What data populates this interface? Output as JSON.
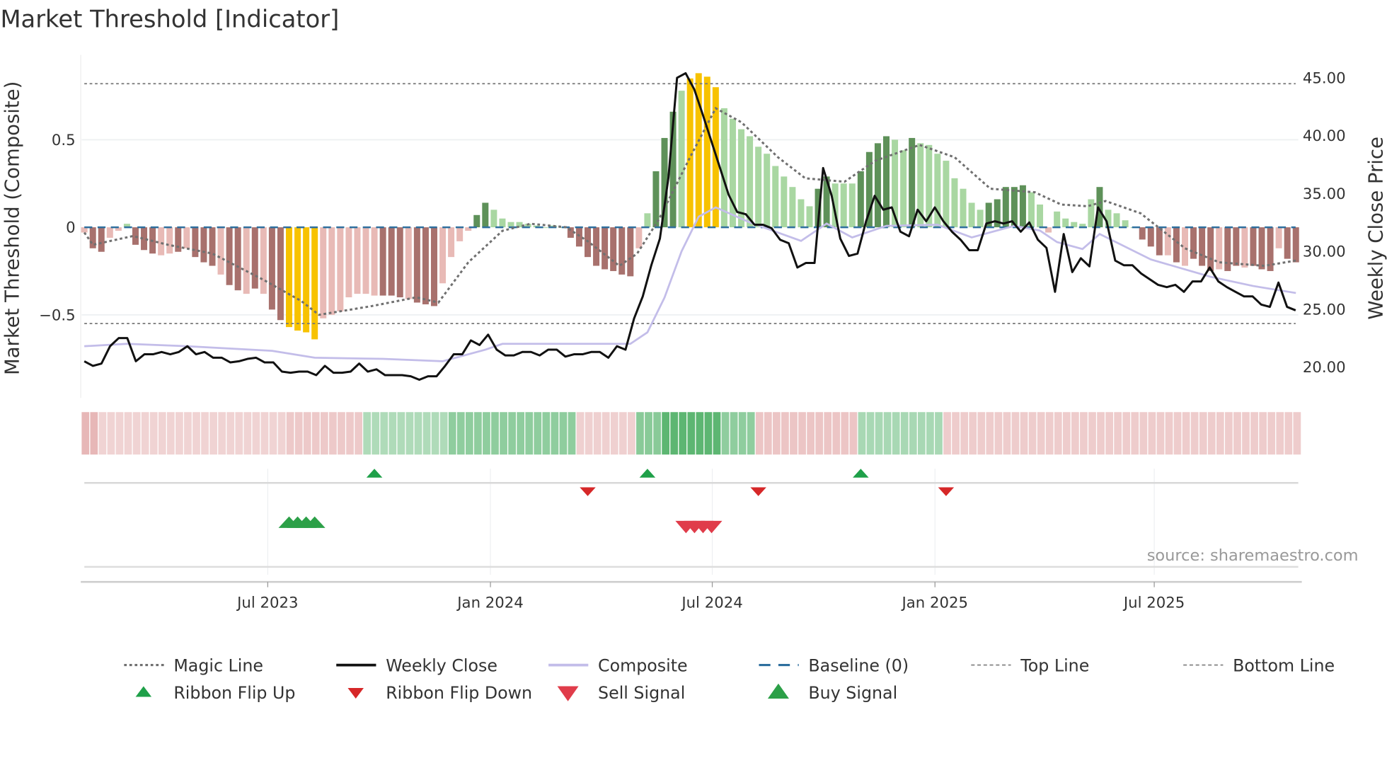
{
  "chart_data": {
    "type": "bar",
    "title": "Market Threshold [Indicator]",
    "ylabel": "Market Threshold (Composite)",
    "ylabel_right": "Weekly Close Price",
    "ylim": [
      -0.96,
      0.97
    ],
    "ylim_right": [
      16.5,
      47.5
    ],
    "yticks": [
      {
        "v": 0.5,
        "label": "0.5"
      },
      {
        "v": 0,
        "label": "0"
      },
      {
        "v": -0.5,
        "label": "−0.5"
      }
    ],
    "yticks_right": [
      {
        "v": 45,
        "label": "45.00"
      },
      {
        "v": 40,
        "label": "40.00"
      },
      {
        "v": 35,
        "label": "35.00"
      },
      {
        "v": 30,
        "label": "30.00"
      },
      {
        "v": 25,
        "label": "25.00"
      },
      {
        "v": 20,
        "label": "20.00"
      }
    ],
    "xticks": [
      {
        "week": 21.5,
        "label": "Jul 2023"
      },
      {
        "week": 47.6,
        "label": "Jan 2024"
      },
      {
        "week": 73.6,
        "label": "Jul 2024"
      },
      {
        "week": 99.7,
        "label": "Jan 2025"
      },
      {
        "week": 125.4,
        "label": "Jul 2025"
      }
    ],
    "top_line": 0.82,
    "bottom_line": -0.55,
    "baseline": 0,
    "composite_bars": [
      -0.03,
      -0.12,
      -0.14,
      -0.06,
      -0.02,
      0.02,
      -0.1,
      -0.13,
      -0.15,
      -0.16,
      -0.15,
      -0.14,
      -0.12,
      -0.17,
      -0.2,
      -0.22,
      -0.27,
      -0.33,
      -0.36,
      -0.38,
      -0.35,
      -0.38,
      -0.47,
      -0.53,
      -0.57,
      -0.59,
      -0.6,
      -0.64,
      -0.52,
      -0.5,
      -0.48,
      -0.4,
      -0.38,
      -0.38,
      -0.39,
      -0.39,
      -0.39,
      -0.4,
      -0.41,
      -0.43,
      -0.44,
      -0.45,
      -0.32,
      -0.17,
      -0.08,
      -0.02,
      0.07,
      0.14,
      0.1,
      0.05,
      0.03,
      0.03,
      0.02,
      0.01,
      0.0,
      0.01,
      0.0,
      -0.06,
      -0.11,
      -0.17,
      -0.22,
      -0.24,
      -0.25,
      -0.27,
      -0.28,
      -0.12,
      0.08,
      0.32,
      0.51,
      0.66,
      0.78,
      0.85,
      0.88,
      0.86,
      0.8,
      0.68,
      0.62,
      0.56,
      0.52,
      0.46,
      0.42,
      0.35,
      0.29,
      0.23,
      0.16,
      0.12,
      0.22,
      0.29,
      0.25,
      0.25,
      0.25,
      0.32,
      0.43,
      0.48,
      0.52,
      0.5,
      0.44,
      0.51,
      0.48,
      0.47,
      0.42,
      0.38,
      0.28,
      0.22,
      0.14,
      0.1,
      0.14,
      0.16,
      0.23,
      0.23,
      0.24,
      0.2,
      0.13,
      -0.03,
      0.09,
      0.05,
      0.03,
      0.02,
      0.16,
      0.23,
      0.1,
      0.08,
      0.04,
      0.0,
      -0.07,
      -0.11,
      -0.16,
      -0.16,
      -0.2,
      -0.22,
      -0.18,
      -0.22,
      -0.25,
      -0.24,
      -0.25,
      -0.22,
      -0.23,
      -0.22,
      -0.24,
      -0.25,
      -0.12,
      -0.18,
      -0.2
    ],
    "bar_states": "LDDLLgDDDLLDLDDDLDDLDLDDYYYYLLLLLLLDDDLDDDLLLLGGgggggggggDDDDDDDDLgGGGgYYYYgggggggggggGGgggGGGGggGggggggggGGGGGggLgggggGggggDDDLDLDDDLDDLDDDLDD",
    "bar_state_colors": {
      "D": "#a8716d",
      "L": "#e8bab6",
      "Y": "#f7c200",
      "G": "#5e9159",
      "g": "#a9d7a2"
    },
    "weekly_close": [
      20.5,
      20.1,
      20.3,
      21.8,
      22.5,
      22.5,
      20.5,
      21.1,
      21.1,
      21.3,
      21.1,
      21.3,
      21.8,
      21.1,
      21.3,
      20.8,
      20.8,
      20.4,
      20.5,
      20.7,
      20.8,
      20.4,
      20.4,
      19.6,
      19.5,
      19.6,
      19.6,
      19.3,
      20.1,
      19.5,
      19.5,
      19.6,
      20.3,
      19.6,
      19.8,
      19.3,
      19.3,
      19.3,
      19.2,
      18.9,
      19.2,
      19.2,
      20.1,
      21.1,
      21.1,
      22.3,
      21.9,
      22.8,
      21.5,
      21.0,
      21.0,
      21.3,
      21.3,
      21.0,
      21.5,
      21.5,
      20.9,
      21.1,
      21.1,
      21.3,
      21.3,
      20.8,
      21.8,
      21.5,
      24.2,
      26.1,
      28.8,
      31.1,
      36.4,
      45.0,
      45.4,
      44.0,
      41.8,
      39.5,
      37.2,
      34.9,
      33.4,
      33.2,
      32.3,
      32.3,
      32.0,
      31.0,
      30.7,
      28.6,
      29.0,
      29.0,
      37.2,
      34.8,
      31.1,
      29.6,
      29.8,
      32.6,
      34.8,
      33.6,
      33.8,
      31.7,
      31.3,
      33.6,
      32.6,
      33.8,
      32.6,
      31.7,
      31.0,
      30.1,
      30.1,
      32.4,
      32.6,
      32.4,
      32.6,
      31.7,
      32.5,
      31.0,
      30.3,
      26.5,
      31.5,
      28.2,
      29.4,
      28.7,
      33.8,
      32.6,
      29.2,
      28.8,
      28.8,
      28.1,
      27.6,
      27.1,
      26.9,
      27.1,
      26.5,
      27.4,
      27.4,
      28.6,
      27.4,
      26.9,
      26.5,
      26.1,
      26.1,
      25.4,
      25.2,
      27.3,
      25.2,
      24.9
    ],
    "composite_line": [
      [
        0,
        21.8
      ],
      [
        5,
        22
      ],
      [
        12,
        21.8
      ],
      [
        22,
        21.4
      ],
      [
        27,
        20.8
      ],
      [
        35,
        20.7
      ],
      [
        42,
        20.5
      ],
      [
        47,
        21.5
      ],
      [
        49,
        22
      ],
      [
        56,
        22
      ],
      [
        64,
        22
      ],
      [
        66,
        23
      ],
      [
        68,
        26
      ],
      [
        70,
        30
      ],
      [
        72,
        33
      ],
      [
        74,
        33.8
      ],
      [
        78,
        32.5
      ],
      [
        84,
        30.9
      ],
      [
        87,
        32.4
      ],
      [
        90,
        31.2
      ],
      [
        94,
        32.2
      ],
      [
        100,
        32.3
      ],
      [
        104,
        31.2
      ],
      [
        109,
        32.2
      ],
      [
        112,
        31.8
      ],
      [
        114,
        30.8
      ],
      [
        117,
        30.2
      ],
      [
        119,
        31.5
      ],
      [
        125,
        29.3
      ],
      [
        132,
        27.8
      ],
      [
        137,
        27
      ],
      [
        142,
        26.4
      ]
    ],
    "magic_line": [
      [
        0,
        -0.03
      ],
      [
        1,
        -0.1
      ],
      [
        5.7,
        -0.05
      ],
      [
        9.8,
        -0.1
      ],
      [
        15,
        -0.15
      ],
      [
        21,
        -0.3
      ],
      [
        25.4,
        -0.42
      ],
      [
        27.5,
        -0.5
      ],
      [
        33.7,
        -0.45
      ],
      [
        38.9,
        -0.4
      ],
      [
        41.5,
        -0.43
      ],
      [
        45,
        -0.2
      ],
      [
        49,
        -0.02
      ],
      [
        52.3,
        0.02
      ],
      [
        56.5,
        0
      ],
      [
        59,
        -0.08
      ],
      [
        62.7,
        -0.22
      ],
      [
        64.8,
        -0.15
      ],
      [
        67.4,
        0.05
      ],
      [
        71,
        0.4
      ],
      [
        74,
        0.68
      ],
      [
        77,
        0.6
      ],
      [
        81.3,
        0.4
      ],
      [
        84.5,
        0.28
      ],
      [
        89.1,
        0.26
      ],
      [
        92.7,
        0.38
      ],
      [
        97.9,
        0.47
      ],
      [
        102,
        0.4
      ],
      [
        106.2,
        0.22
      ],
      [
        111.4,
        0.2
      ],
      [
        114.5,
        0.13
      ],
      [
        117.6,
        0.12
      ],
      [
        119.7,
        0.15
      ],
      [
        123.8,
        0.08
      ],
      [
        129,
        -0.12
      ],
      [
        133,
        -0.2
      ],
      [
        138.3,
        -0.22
      ],
      [
        142,
        -0.19
      ]
    ],
    "ribbon_segments": [
      {
        "from": 0,
        "to": 2,
        "v": -0.7
      },
      {
        "from": 2,
        "to": 24,
        "v": -0.3
      },
      {
        "from": 24,
        "to": 33,
        "v": -0.45
      },
      {
        "from": 33,
        "to": 43,
        "v": 0.3
      },
      {
        "from": 43,
        "to": 58,
        "v": 0.55
      },
      {
        "from": 58,
        "to": 65,
        "v": -0.35
      },
      {
        "from": 65,
        "to": 68,
        "v": 0.6
      },
      {
        "from": 68,
        "to": 75,
        "v": 0.95
      },
      {
        "from": 75,
        "to": 79,
        "v": 0.55
      },
      {
        "from": 79,
        "to": 91,
        "v": -0.5
      },
      {
        "from": 91,
        "to": 101,
        "v": 0.35
      },
      {
        "from": 101,
        "to": 143,
        "v": -0.4
      }
    ],
    "ribbon_flip_up": [
      34,
      66,
      91
    ],
    "ribbon_flip_down": [
      59,
      79,
      101
    ],
    "buy_signals": [
      24,
      25,
      26,
      27
    ],
    "sell_signals": [
      70,
      71,
      72,
      73
    ],
    "colors": {
      "weekly_close": "#111111",
      "composite": "#c3bde9",
      "magic": "#707070",
      "baseline": "#2e6f9e",
      "flip_up": "#1fa049",
      "flip_down": "#d62728",
      "buy": "#2ca048",
      "sell": "#e03c4a"
    },
    "legend": [
      {
        "label": "Magic Line",
        "key": "magic"
      },
      {
        "label": "Weekly Close",
        "key": "close"
      },
      {
        "label": "Composite",
        "key": "composite"
      },
      {
        "label": "Baseline (0)",
        "key": "baseline"
      },
      {
        "label": "Top Line",
        "key": "top"
      },
      {
        "label": "Bottom Line",
        "key": "bottom"
      },
      {
        "label": "Ribbon Flip Up",
        "key": "flipup"
      },
      {
        "label": "Ribbon Flip Down",
        "key": "flipdown"
      },
      {
        "label": "Sell Signal",
        "key": "sell"
      },
      {
        "label": "Buy Signal",
        "key": "buy"
      }
    ],
    "source": "source: sharemaestro.com"
  }
}
